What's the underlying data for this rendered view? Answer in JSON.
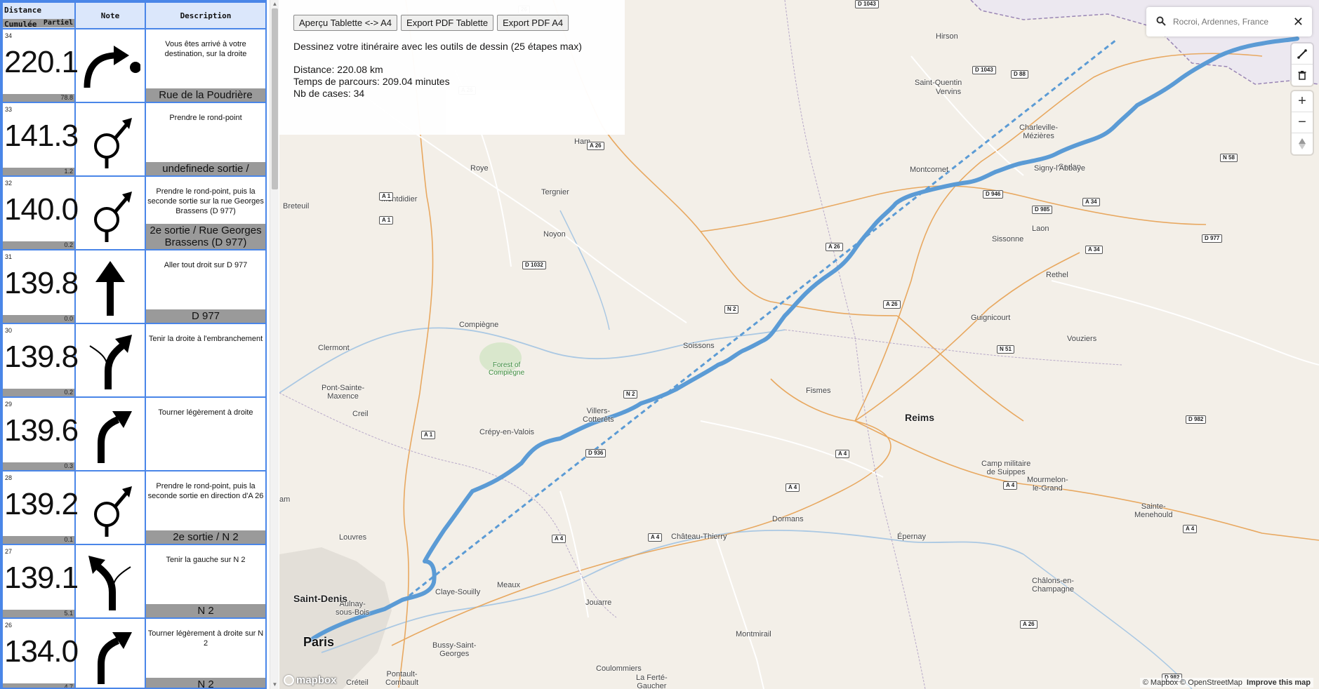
{
  "roadbook": {
    "headers": {
      "distance_cumulative": "Distance Cumulée",
      "partial": "Partiel",
      "note": "Note",
      "description": "Description"
    },
    "rows": [
      {
        "index": "34",
        "cumulative": "220.1",
        "partial": "78.8",
        "icon": "arrive-right-icon",
        "text": "Vous êtes arrivé à votre destination, sur la droite",
        "road": "Rue de la Poudrière"
      },
      {
        "index": "33",
        "cumulative": "141.3",
        "partial": "1.2",
        "icon": "roundabout-icon",
        "text": "Prendre le rond-point",
        "road": "undefinede sortie /"
      },
      {
        "index": "32",
        "cumulative": "140.0",
        "partial": "0.2",
        "icon": "roundabout-icon",
        "text": "Prendre le rond-point, puis la seconde sortie sur la rue Georges Brassens (D 977)",
        "road": "2e sortie / Rue Georges Brassens (D 977)"
      },
      {
        "index": "31",
        "cumulative": "139.8",
        "partial": "0.0",
        "icon": "straight-arrow-icon",
        "text": "Aller tout droit sur D 977",
        "road": "D 977"
      },
      {
        "index": "30",
        "cumulative": "139.8",
        "partial": "0.2",
        "icon": "fork-right-icon",
        "text": "Tenir la droite à l'embranchement",
        "road": ""
      },
      {
        "index": "29",
        "cumulative": "139.6",
        "partial": "0.3",
        "icon": "slight-right-icon",
        "text": "Tourner légèrement à droite",
        "road": ""
      },
      {
        "index": "28",
        "cumulative": "139.2",
        "partial": "0.1",
        "icon": "roundabout-icon",
        "text": "Prendre le rond-point, puis la seconde sortie en direction d'A 26",
        "road": "2e sortie / N 2"
      },
      {
        "index": "27",
        "cumulative": "139.1",
        "partial": "5.1",
        "icon": "fork-left-icon",
        "text": "Tenir la gauche sur N 2",
        "road": "N 2"
      },
      {
        "index": "26",
        "cumulative": "134.0",
        "partial": "4.7",
        "icon": "slight-right-icon",
        "text": "Tourner légèrement à droite sur N 2",
        "road": "N 2"
      }
    ]
  },
  "info": {
    "buttons": [
      "Aperçu Tablette <-> A4",
      "Export PDF Tablette",
      "Export PDF A4"
    ],
    "instruction": "Dessinez votre itinéraire avec les outils de dessin (25 étapes max)",
    "distance": "Distance: 220.08 km",
    "time": "Temps de parcours: 209.04 minutes",
    "cases": "Nb de cases: 34"
  },
  "search": {
    "placeholder": "Rocroi, Ardennes, France",
    "close": "✕"
  },
  "map": {
    "cities": [
      {
        "name": "Hirson",
        "cls": ""
      },
      {
        "name": "Saint-Quentin",
        "cls": ""
      },
      {
        "name": "Vervins",
        "cls": ""
      },
      {
        "name": "Charleville-\nMézières",
        "cls": ""
      },
      {
        "name": "Sedan",
        "cls": ""
      },
      {
        "name": "Ham",
        "cls": ""
      },
      {
        "name": "Roye",
        "cls": ""
      },
      {
        "name": "Tergnier",
        "cls": ""
      },
      {
        "name": "Signy-l'Abbaye",
        "cls": ""
      },
      {
        "name": "Montdidier",
        "cls": ""
      },
      {
        "name": "Breteuil",
        "cls": ""
      },
      {
        "name": "Montcornet",
        "cls": ""
      },
      {
        "name": "Noyon",
        "cls": ""
      },
      {
        "name": "Laon",
        "cls": ""
      },
      {
        "name": "Sissonne",
        "cls": ""
      },
      {
        "name": "Rethel",
        "cls": ""
      },
      {
        "name": "Compiègne",
        "cls": ""
      },
      {
        "name": "Guignicourt",
        "cls": ""
      },
      {
        "name": "Clermont",
        "cls": ""
      },
      {
        "name": "Soissons",
        "cls": ""
      },
      {
        "name": "Vouziers",
        "cls": ""
      },
      {
        "name": "Forest of\nCompiègne",
        "cls": "green"
      },
      {
        "name": "Pont-Sainte-\nMaxence",
        "cls": ""
      },
      {
        "name": "Fismes",
        "cls": ""
      },
      {
        "name": "Reims",
        "cls": "big"
      },
      {
        "name": "Creil",
        "cls": ""
      },
      {
        "name": "Villers-\nCotterêts",
        "cls": ""
      },
      {
        "name": "Crépy-en-Valois",
        "cls": ""
      },
      {
        "name": "Camp militaire\nde Suippes",
        "cls": ""
      },
      {
        "name": "Mourmelon-\nle-Grand",
        "cls": ""
      },
      {
        "name": "Sainte-\nMenehould",
        "cls": ""
      },
      {
        "name": "Louvres",
        "cls": ""
      },
      {
        "name": "Dormans",
        "cls": ""
      },
      {
        "name": "Château-Thierry",
        "cls": ""
      },
      {
        "name": "Épernay",
        "cls": ""
      },
      {
        "name": "Meaux",
        "cls": ""
      },
      {
        "name": "Saint-Denis",
        "cls": "big"
      },
      {
        "name": "Aulnay-\nsous-Bois",
        "cls": ""
      },
      {
        "name": "Claye-Souilly",
        "cls": ""
      },
      {
        "name": "Jouarre",
        "cls": ""
      },
      {
        "name": "Châlons-en-\nChampagne",
        "cls": ""
      },
      {
        "name": "Paris",
        "cls": "huge"
      },
      {
        "name": "Bussy-Saint-\nGeorges",
        "cls": ""
      },
      {
        "name": "Montmirail",
        "cls": ""
      },
      {
        "name": "Coulommiers",
        "cls": ""
      },
      {
        "name": "Pontault-\nCombault",
        "cls": ""
      },
      {
        "name": "La Ferté-\nGaucher",
        "cls": ""
      },
      {
        "name": "Créteil",
        "cls": ""
      },
      {
        "name": "am",
        "cls": ""
      }
    ],
    "shields": [
      "26",
      "D 1043",
      "D 88",
      "D 1043",
      "A 26",
      "A 26",
      "A 1",
      "A 1",
      "D 946",
      "D 985",
      "A 34",
      "D 977",
      "D 1032",
      "A 26",
      "A 34",
      "A 26",
      "N 2",
      "N 51",
      "N 2",
      "A 1",
      "D 936",
      "A 4",
      "D 982",
      "A 4",
      "A 4",
      "A 4",
      "A 4",
      "A 26",
      "A 4",
      "N 58",
      "D 982"
    ]
  },
  "attribution": {
    "text": "© Mapbox © OpenStreetMap",
    "improve": "Improve this map",
    "logo": "mapbox"
  },
  "colors": {
    "route": "#5b9bd5",
    "panel_border": "#4a86e8",
    "header_bg": "#dbe7fb",
    "bar_gray": "#9a9a9a"
  }
}
